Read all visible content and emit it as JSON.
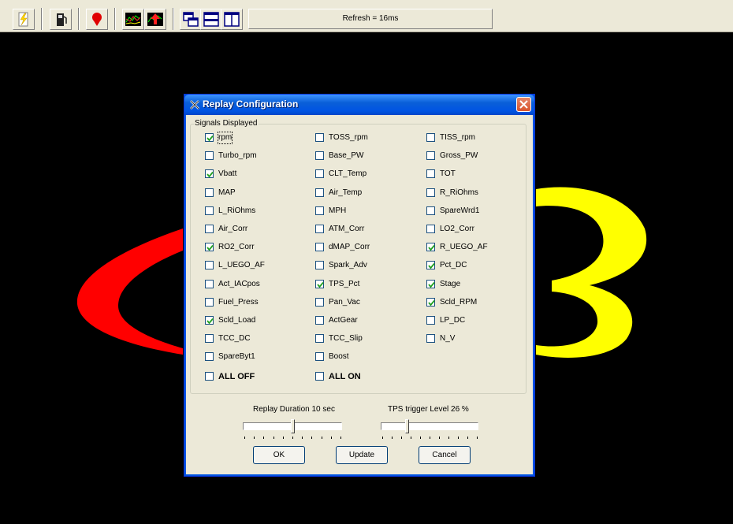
{
  "toolbar": {
    "buttons": [
      {
        "icon": "lightning-icon"
      },
      {
        "icon": "fuel-pump-icon"
      },
      {
        "icon": "pin-icon"
      },
      {
        "icon": "chart-icon"
      },
      {
        "icon": "chart-up-icon"
      },
      {
        "icon": "cascade-windows-icon"
      },
      {
        "icon": "tile-horizontal-icon"
      },
      {
        "icon": "tile-vertical-icon"
      }
    ],
    "refresh_text": "Refresh = 16ms"
  },
  "dialog": {
    "title": "Replay Configuration",
    "group_label": "Signals Displayed",
    "signals": [
      {
        "label": "rpm",
        "checked": true
      },
      {
        "label": "TOSS_rpm",
        "checked": false
      },
      {
        "label": "TISS_rpm",
        "checked": false
      },
      {
        "label": "Turbo_rpm",
        "checked": false
      },
      {
        "label": "Base_PW",
        "checked": false
      },
      {
        "label": "Gross_PW",
        "checked": false
      },
      {
        "label": "Vbatt",
        "checked": true
      },
      {
        "label": "CLT_Temp",
        "checked": false
      },
      {
        "label": "TOT",
        "checked": false
      },
      {
        "label": "MAP",
        "checked": false
      },
      {
        "label": "Air_Temp",
        "checked": false
      },
      {
        "label": "R_RiOhms",
        "checked": false
      },
      {
        "label": "L_RiOhms",
        "checked": false
      },
      {
        "label": "MPH",
        "checked": false
      },
      {
        "label": "SpareWrd1",
        "checked": false
      },
      {
        "label": "Air_Corr",
        "checked": false
      },
      {
        "label": "ATM_Corr",
        "checked": false
      },
      {
        "label": "LO2_Corr",
        "checked": false
      },
      {
        "label": "RO2_Corr",
        "checked": true
      },
      {
        "label": "dMAP_Corr",
        "checked": false
      },
      {
        "label": "R_UEGO_AF",
        "checked": true
      },
      {
        "label": "L_UEGO_AF",
        "checked": false
      },
      {
        "label": "Spark_Adv",
        "checked": false
      },
      {
        "label": "Pct_DC",
        "checked": true
      },
      {
        "label": "Act_IACpos",
        "checked": false
      },
      {
        "label": "TPS_Pct",
        "checked": true
      },
      {
        "label": "Stage",
        "checked": true
      },
      {
        "label": "Fuel_Press",
        "checked": false
      },
      {
        "label": "Pan_Vac",
        "checked": false
      },
      {
        "label": "Scld_RPM",
        "checked": true
      },
      {
        "label": "Scld_Load",
        "checked": true
      },
      {
        "label": "ActGear",
        "checked": false
      },
      {
        "label": "LP_DC",
        "checked": false
      },
      {
        "label": "TCC_DC",
        "checked": false
      },
      {
        "label": "TCC_Slip",
        "checked": false
      },
      {
        "label": "N_V",
        "checked": false
      },
      {
        "label": "SpareByt1",
        "checked": false
      },
      {
        "label": "Boost",
        "checked": false
      }
    ],
    "all_off_label": "ALL OFF",
    "all_on_label": "ALL ON",
    "replay_duration_label": "Replay Duration   10 sec",
    "replay_duration_value": 10,
    "tps_trigger_label": "TPS trigger Level   26 %",
    "tps_trigger_value": 26,
    "ok_label": "OK",
    "update_label": "Update",
    "cancel_label": "Cancel"
  },
  "colors": {
    "background": "#000000",
    "logo_red": "#ff0000",
    "logo_yellow": "#ffff00",
    "title_bar": "#0054e3",
    "dialog_face": "#ece9d8",
    "check_mark": "#21a121"
  }
}
